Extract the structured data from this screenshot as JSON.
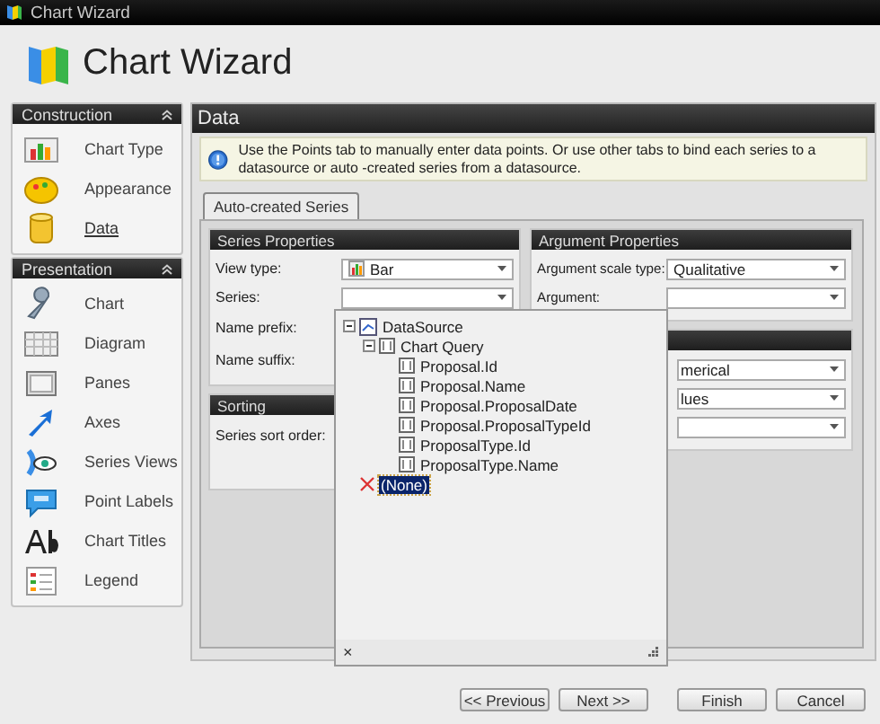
{
  "window": {
    "title": "Chart Wizard"
  },
  "header": {
    "title": "Chart Wizard"
  },
  "sidebar": {
    "groups": [
      {
        "title": "Construction",
        "expanded": true,
        "items": [
          {
            "label": "Chart Type",
            "selected": false
          },
          {
            "label": "Appearance",
            "selected": false
          },
          {
            "label": "Data",
            "selected": true
          }
        ]
      },
      {
        "title": "Presentation",
        "expanded": true,
        "items": [
          {
            "label": "Chart",
            "selected": false
          },
          {
            "label": "Diagram",
            "selected": false
          },
          {
            "label": "Panes",
            "selected": false
          },
          {
            "label": "Axes",
            "selected": false
          },
          {
            "label": "Series Views",
            "selected": false
          },
          {
            "label": "Point Labels",
            "selected": false
          },
          {
            "label": "Chart Titles",
            "selected": false
          },
          {
            "label": "Legend",
            "selected": false
          }
        ]
      }
    ]
  },
  "page": {
    "title": "Data",
    "info": "Use the Points tab to manually enter data points. Or use other tabs to bind each series to a datasource or auto -created series from a datasource.",
    "tabs": [
      {
        "label": "Auto-created Series",
        "selected": true
      }
    ],
    "series_properties": {
      "title": "Series Properties",
      "fields": [
        {
          "label": "View type:",
          "kind": "combo",
          "value": "Bar",
          "has_icon": true
        },
        {
          "label": "Series:",
          "kind": "combo"
        },
        {
          "label": "Name prefix:",
          "kind": "label"
        },
        {
          "label": "Name suffix:",
          "kind": "label"
        }
      ]
    },
    "sorting": {
      "title": "Sorting",
      "fields": [
        {
          "label": "Series sort order:",
          "kind": "label"
        }
      ]
    },
    "argument_properties": {
      "title": "Argument Properties",
      "fields": [
        {
          "label": "Argument scale type:",
          "kind": "combo",
          "value": "Qualitative"
        },
        {
          "label": "Argument:",
          "kind": "combo"
        }
      ]
    },
    "panel_4": {
      "fields": [
        {
          "kind": "combo",
          "value": "merical"
        },
        {
          "kind": "combo",
          "value": "lues"
        },
        {
          "kind": "combo"
        }
      ]
    },
    "series_dropdown": {
      "tree": [
        {
          "label": "DataSource",
          "kind": "source",
          "expanded": true,
          "selected": false,
          "children": [
            {
              "label": "Chart Query",
              "kind": "query",
              "expanded": true,
              "selected": false,
              "children": [
                {
                  "label": "Proposal.Id",
                  "kind": "field",
                  "selected": false
                },
                {
                  "label": "Proposal.Name",
                  "kind": "field",
                  "selected": false
                },
                {
                  "label": "Proposal.ProposalDate",
                  "kind": "field",
                  "selected": false
                },
                {
                  "label": "Proposal.ProposalTypeId",
                  "kind": "field",
                  "selected": false
                },
                {
                  "label": "ProposalType.Id",
                  "kind": "field",
                  "selected": false
                },
                {
                  "label": "ProposalType.Name",
                  "kind": "field",
                  "selected": false
                }
              ]
            }
          ]
        },
        {
          "label": "(None)",
          "kind": "none",
          "selected": true
        }
      ],
      "close": "×"
    }
  },
  "buttons": [
    "<< Previous",
    "Next >>",
    "Finish",
    "Cancel"
  ]
}
